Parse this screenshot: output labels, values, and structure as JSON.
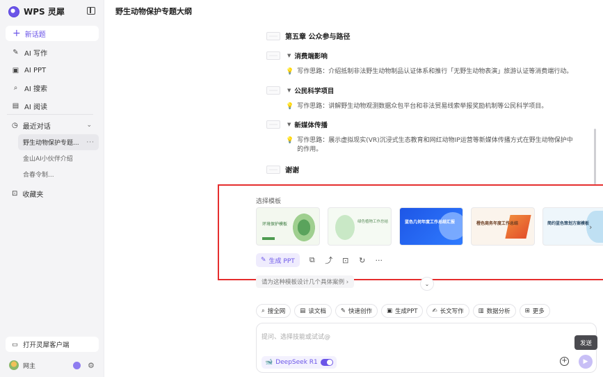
{
  "app": {
    "name": "WPS 灵犀"
  },
  "sidebar": {
    "new_topic": "新话题",
    "nav": [
      {
        "label": "AI 写作",
        "icon": "pen-icon"
      },
      {
        "label": "AI PPT",
        "icon": "ppt-icon"
      },
      {
        "label": "AI 搜索",
        "icon": "search-icon"
      },
      {
        "label": "AI 阅读",
        "icon": "book-icon"
      }
    ],
    "recent": "最近对话",
    "conversations": [
      "野生动物保护专题...",
      "金山AI小伙伴介绍",
      "合春令制..."
    ],
    "favorites": "收藏夹",
    "open_client": "打开灵犀客户端",
    "user": "网主"
  },
  "main": {
    "title": "野生动物保护专题大纲",
    "outline": {
      "chapter5": "第五章 公众参与路径",
      "s1": "消费端影响",
      "s1_hint": "写作思路：介绍抵制非法野生动物制品认证体系和推行「无野生动物表演」旅游认证等消费端行动。",
      "s2": "公民科学项目",
      "s2_hint": "写作思路：讲解野生动物观测数据众包平台和非法贸易线索举报奖励机制等公民科学项目。",
      "s3": "新媒体传播",
      "s3_hint": "写作思路：展示虚拟现实(VR)沉浸式生态教育和网红动物IP运营等新媒体传播方式在野生动物保护中的作用。",
      "thanks": "谢谢"
    },
    "template_label": "选择模板",
    "templates": [
      {
        "title": "环境保护模板"
      },
      {
        "title": "绿色植物工作总结"
      },
      {
        "title": "蓝色几何年度工作总结汇报"
      },
      {
        "title": "橙色商务年度工作总结"
      },
      {
        "title": "简约蓝色策划方案模板"
      }
    ],
    "actions": {
      "gen_ppt": "生成 PPT"
    },
    "suggestion": "请为这种模板设计几个具体案例 ›",
    "tools": [
      {
        "label": "搜全网",
        "icon": "search-icon"
      },
      {
        "label": "读文档",
        "icon": "doc-icon"
      },
      {
        "label": "快速创作",
        "icon": "pen-icon"
      },
      {
        "label": "生成PPT",
        "icon": "ppt-icon"
      },
      {
        "label": "长文写作",
        "icon": "longtext-icon"
      },
      {
        "label": "数据分析",
        "icon": "chart-icon"
      },
      {
        "label": "更多",
        "icon": "grid-icon"
      }
    ],
    "composer": {
      "placeholder": "提问、选择技能或试试@",
      "model": "DeepSeek R1",
      "send_tooltip": "发送"
    }
  },
  "colors": {
    "accent": "#6b55e8",
    "highlight_box": "#e52d2d"
  }
}
